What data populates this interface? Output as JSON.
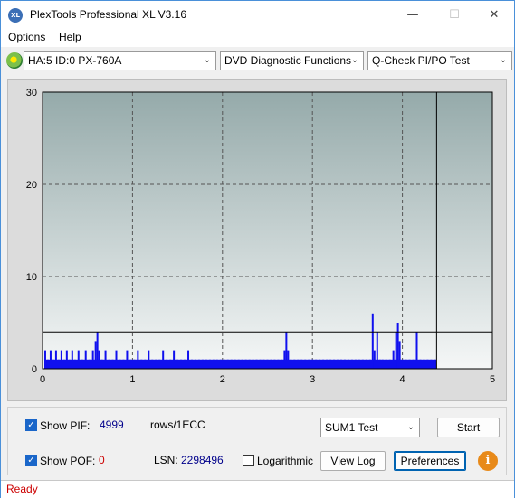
{
  "window": {
    "title": "PlexTools Professional XL V3.16",
    "icon_label": "XL",
    "minimize_glyph": "—",
    "maximize_glyph": "☐",
    "close_glyph": "✕"
  },
  "menu": {
    "items": [
      "Options",
      "Help"
    ]
  },
  "toolbar": {
    "drive_icon": "disc-drive-icon",
    "drive_select": "HA:5 ID:0  PX-760A",
    "function_select": "DVD Diagnostic Functions",
    "test_select": "Q-Check PI/PO Test",
    "dropdown_glyph": "⌄"
  },
  "chart_data": {
    "type": "bar",
    "xlim": [
      0,
      5
    ],
    "ylim": [
      0,
      30
    ],
    "x_ticks": [
      "0",
      "1",
      "2",
      "3",
      "4",
      "5"
    ],
    "y_ticks": [
      "0",
      "10",
      "20",
      "30"
    ],
    "grid": true,
    "threshold": 4,
    "scan_end_x": 4.38,
    "colors": {
      "bars": "#1010ee",
      "plot_top": "#95aaaa",
      "plot_bottom": "#f5f7f7",
      "frame": "#000000"
    },
    "series": [
      {
        "values": [
          [
            0.03,
            2
          ],
          [
            0.06,
            1
          ],
          [
            0.09,
            2
          ],
          [
            0.12,
            1
          ],
          [
            0.15,
            2
          ],
          [
            0.18,
            1
          ],
          [
            0.21,
            2
          ],
          [
            0.24,
            1
          ],
          [
            0.27,
            2
          ],
          [
            0.3,
            1
          ],
          [
            0.33,
            2
          ],
          [
            0.36,
            1
          ],
          [
            0.4,
            2
          ],
          [
            0.44,
            1
          ],
          [
            0.48,
            2
          ],
          [
            0.52,
            1
          ],
          [
            0.56,
            2
          ],
          [
            0.59,
            3
          ],
          [
            0.61,
            4
          ],
          [
            0.63,
            2
          ],
          [
            0.66,
            1
          ],
          [
            0.7,
            2
          ],
          [
            0.74,
            1
          ],
          [
            0.78,
            1
          ],
          [
            0.82,
            2
          ],
          [
            0.86,
            1
          ],
          [
            0.9,
            1
          ],
          [
            0.94,
            2
          ],
          [
            0.98,
            1
          ],
          [
            1.02,
            1
          ],
          [
            1.06,
            2
          ],
          [
            1.1,
            1
          ],
          [
            1.14,
            1
          ],
          [
            1.18,
            2
          ],
          [
            1.22,
            1
          ],
          [
            1.26,
            1
          ],
          [
            1.3,
            1
          ],
          [
            1.34,
            2
          ],
          [
            1.38,
            1
          ],
          [
            1.42,
            1
          ],
          [
            1.46,
            2
          ],
          [
            1.5,
            1
          ],
          [
            1.54,
            1
          ],
          [
            1.58,
            1
          ],
          [
            1.62,
            2
          ],
          [
            1.66,
            1
          ],
          [
            1.7,
            1
          ],
          [
            1.74,
            1
          ],
          [
            1.78,
            1
          ],
          [
            1.82,
            1
          ],
          [
            1.86,
            1
          ],
          [
            1.9,
            1
          ],
          [
            1.94,
            1
          ],
          [
            1.98,
            1
          ],
          [
            2.02,
            1
          ],
          [
            2.06,
            1
          ],
          [
            2.1,
            1
          ],
          [
            2.14,
            1
          ],
          [
            2.18,
            1
          ],
          [
            2.22,
            1
          ],
          [
            2.26,
            1
          ],
          [
            2.3,
            1
          ],
          [
            2.34,
            1
          ],
          [
            2.38,
            1
          ],
          [
            2.42,
            1
          ],
          [
            2.46,
            1
          ],
          [
            2.5,
            1
          ],
          [
            2.54,
            1
          ],
          [
            2.58,
            1
          ],
          [
            2.62,
            1
          ],
          [
            2.66,
            1
          ],
          [
            2.69,
            2
          ],
          [
            2.71,
            4
          ],
          [
            2.73,
            2
          ],
          [
            2.76,
            1
          ],
          [
            2.8,
            1
          ],
          [
            2.84,
            1
          ],
          [
            2.88,
            1
          ],
          [
            2.92,
            1
          ],
          [
            2.96,
            1
          ],
          [
            3.0,
            1
          ],
          [
            3.04,
            1
          ],
          [
            3.08,
            1
          ],
          [
            3.12,
            1
          ],
          [
            3.16,
            1
          ],
          [
            3.2,
            1
          ],
          [
            3.24,
            1
          ],
          [
            3.28,
            1
          ],
          [
            3.32,
            1
          ],
          [
            3.36,
            1
          ],
          [
            3.4,
            1
          ],
          [
            3.44,
            1
          ],
          [
            3.48,
            1
          ],
          [
            3.52,
            1
          ],
          [
            3.56,
            1
          ],
          [
            3.6,
            1
          ],
          [
            3.64,
            1
          ],
          [
            3.67,
            6
          ],
          [
            3.69,
            2
          ],
          [
            3.72,
            4
          ],
          [
            3.75,
            1
          ],
          [
            3.78,
            1
          ],
          [
            3.82,
            1
          ],
          [
            3.86,
            1
          ],
          [
            3.9,
            2
          ],
          [
            3.93,
            4
          ],
          [
            3.95,
            5
          ],
          [
            3.97,
            3
          ],
          [
            4.0,
            1
          ],
          [
            4.04,
            1
          ],
          [
            4.08,
            1
          ],
          [
            4.12,
            1
          ],
          [
            4.16,
            4
          ],
          [
            4.2,
            1
          ],
          [
            4.24,
            1
          ],
          [
            4.28,
            1
          ],
          [
            4.32,
            1
          ],
          [
            4.36,
            1
          ]
        ]
      }
    ]
  },
  "controls": {
    "show_pif_label": "Show PIF:",
    "pif_value": "4999",
    "unit": "rows/1ECC",
    "show_pof_label": "Show POF:",
    "pof_value": "0",
    "lsn_label": "LSN:",
    "lsn_value": "2298496",
    "logarithmic_label": "Logarithmic",
    "sum_select": "SUM1 Test",
    "start_button": "Start",
    "view_log_button": "View Log",
    "preferences_button": "Preferences",
    "info_glyph": "i",
    "check_glyph": "✓",
    "show_pif_checked": true,
    "show_pof_checked": true,
    "logarithmic_checked": false
  },
  "status": {
    "text": "Ready"
  }
}
